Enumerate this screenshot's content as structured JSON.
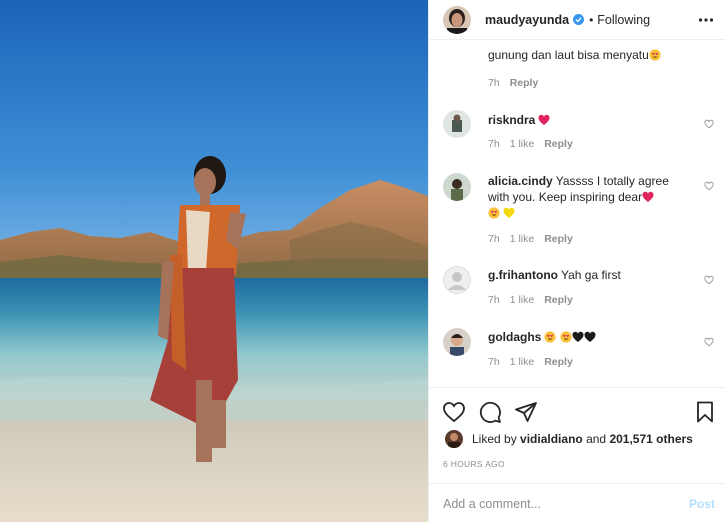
{
  "header": {
    "username": "maudyayunda",
    "separator": "•",
    "following_label": "Following"
  },
  "comments": [
    {
      "user": "",
      "text": "gunung dan laut bisa menyatu",
      "emoji": [
        "heart-eyes"
      ],
      "time": "7h",
      "likes": "",
      "reply_label": "Reply"
    },
    {
      "user": "riskndra",
      "text": "",
      "emoji": [
        "red-heart"
      ],
      "time": "7h",
      "likes": "1 like",
      "reply_label": "Reply"
    },
    {
      "user": "alicia.cindy",
      "text": "Yassss I totally agree with you. Keep inspiring dear",
      "emoji": [
        "red-heart",
        "heart-eyes",
        "yellow-heart"
      ],
      "time": "7h",
      "likes": "1 like",
      "reply_label": "Reply"
    },
    {
      "user": "g.frihantono",
      "text": "Yah ga first",
      "emoji": [],
      "time": "7h",
      "likes": "1 like",
      "reply_label": "Reply"
    },
    {
      "user": "goldaghs",
      "text": "",
      "emoji": [
        "heart-eyes",
        "heart-eyes",
        "black-heart",
        "black-heart"
      ],
      "time": "7h",
      "likes": "1 like",
      "reply_label": "Reply"
    }
  ],
  "likes": {
    "prefix": "Liked by",
    "user": "vidialdiano",
    "conjunction": "and",
    "count": "201,571 others"
  },
  "timestamp": "6 HOURS AGO",
  "add_comment": {
    "placeholder": "Add a comment...",
    "post_label": "Post"
  },
  "colors": {
    "verified": "#3897f0",
    "post_disabled": "#b2dffc",
    "muted": "#8e8e8e",
    "red_heart": "#e0245e"
  }
}
